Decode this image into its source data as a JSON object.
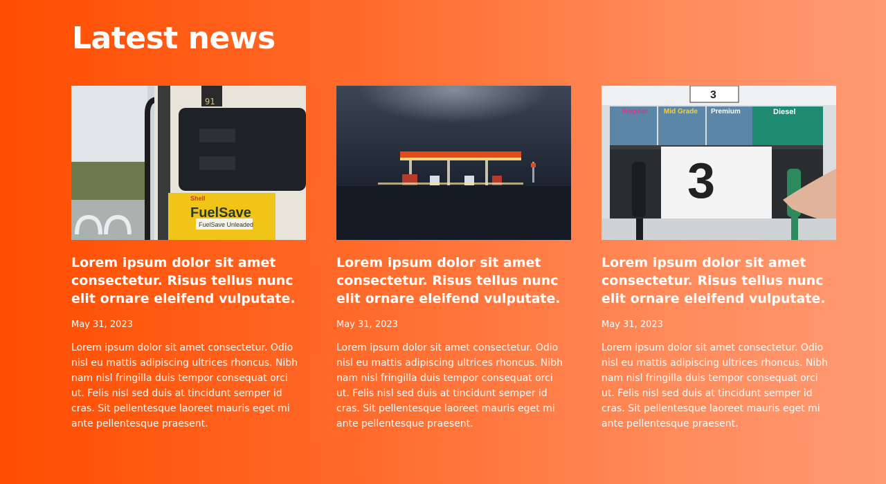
{
  "section": {
    "title": "Latest news"
  },
  "articles": [
    {
      "image_alt": "Fuel pump with FuelSave label",
      "pump_brand": "Shell",
      "pump_label": "FuelSave",
      "pump_sublabel": "FuelSave Unleaded",
      "pump_number": "91",
      "title": "Lorem ipsum dolor sit amet consectetur. Risus tellus nunc elit ornare eleifend vulputate.",
      "date": "May 31, 2023",
      "body": "Lorem ipsum dolor sit amet consectetur. Odio nisl eu mattis adipiscing ultrices rhoncus. Nibh nam nisl fringilla duis tempor consequat orci ut. Felis nisl sed duis at tincidunt semper id cras. Sit pellentesque laoreet mauris eget mi ante pellentesque praesent."
    },
    {
      "image_alt": "Gas station at night",
      "title": "Lorem ipsum dolor sit amet consectetur. Risus tellus nunc elit ornare eleifend vulputate.",
      "date": "May 31, 2023",
      "body": "Lorem ipsum dolor sit amet consectetur. Odio nisl eu mattis adipiscing ultrices rhoncus. Nibh nam nisl fringilla duis tempor consequat orci ut. Felis nisl sed duis at tincidunt semper id cras. Sit pellentesque laoreet mauris eget mi ante pellentesque praesent."
    },
    {
      "image_alt": "Fuel dispenser number 3",
      "grades": [
        "Regular",
        "Mid Grade",
        "Premium",
        "Diesel"
      ],
      "dispenser_number": "3",
      "title": "Lorem ipsum dolor sit amet consectetur. Risus tellus nunc elit ornare eleifend vulputate.",
      "date": "May 31, 2023",
      "body": "Lorem ipsum dolor sit amet consectetur. Odio nisl eu mattis adipiscing ultrices rhoncus. Nibh nam nisl fringilla duis tempor consequat orci ut. Felis nisl sed duis at tincidunt semper id cras. Sit pellentesque laoreet mauris eget mi ante pellentesque praesent."
    }
  ],
  "colors": {
    "gradient_start": "#ff4d00",
    "gradient_end": "#ff9a73",
    "text": "#ffffff"
  }
}
